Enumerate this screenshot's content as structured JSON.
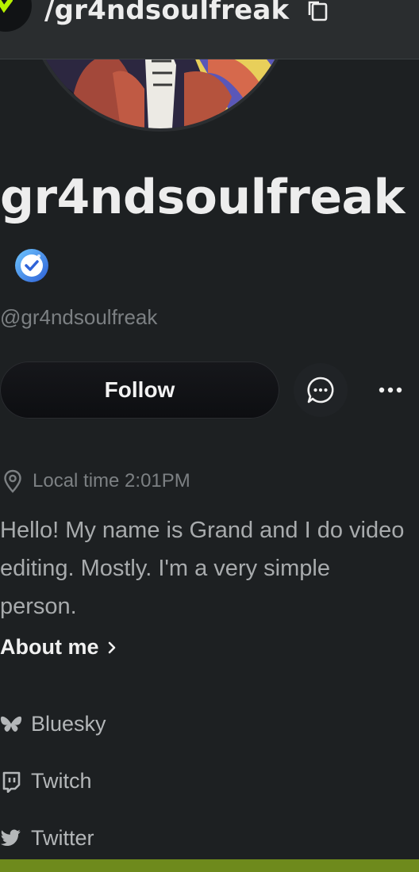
{
  "url_bar": {
    "path": "/gr4ndsoulfreak",
    "copy_icon": "copy-icon",
    "brand_color": "#b6f000"
  },
  "profile": {
    "display_name": "gr4ndsoulfreak",
    "verified_icon": "verified-badge-icon",
    "handle": "@gr4ndsoulfreak",
    "avatar_alt": "anime-style avatar"
  },
  "actions": {
    "follow_label": "Follow",
    "message_icon": "chat-bubble-icon",
    "more_icon": "ellipsis-icon"
  },
  "location": {
    "icon": "map-pin-icon",
    "text": "Local time 2:01PM"
  },
  "bio": {
    "text": "Hello! My name is Grand and I do video editing. Mostly. I'm a very simple person.",
    "about_label": "About me"
  },
  "socials": [
    {
      "label": "Bluesky",
      "icon": "butterfly-icon"
    },
    {
      "label": "Twitch",
      "icon": "twitch-icon"
    },
    {
      "label": "Twitter",
      "icon": "twitter-bird-icon"
    }
  ],
  "colors": {
    "background": "#1d2022",
    "accent_bottom_bar": "#6e8a1c"
  }
}
